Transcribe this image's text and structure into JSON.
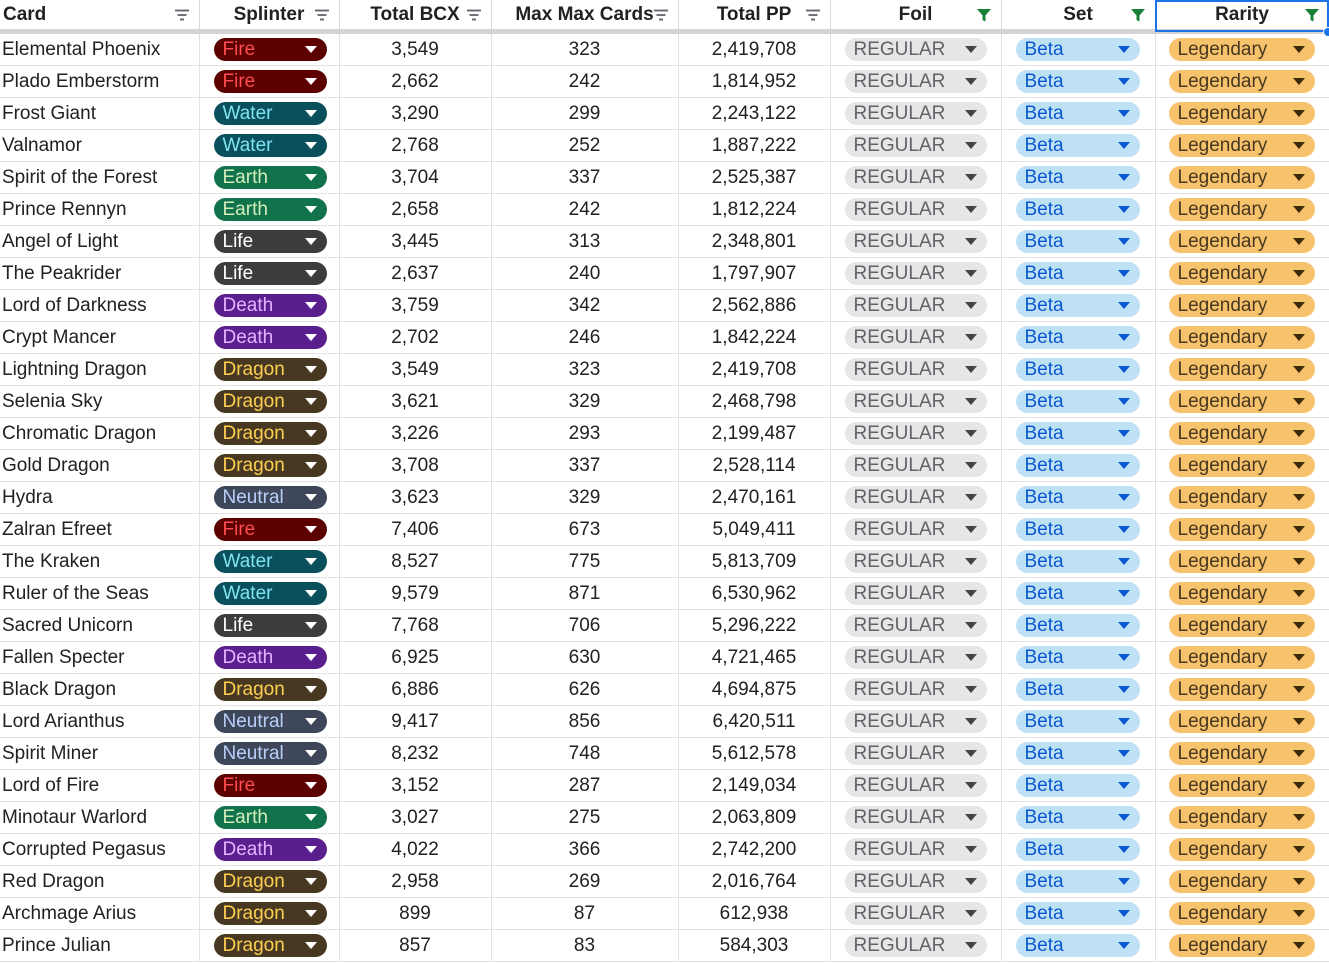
{
  "columns": [
    {
      "label": "Card",
      "filter_active": false
    },
    {
      "label": "Splinter",
      "filter_active": false
    },
    {
      "label": "Total BCX",
      "filter_active": false
    },
    {
      "label": "Max Max Cards",
      "filter_active": false
    },
    {
      "label": "Total PP",
      "filter_active": false
    },
    {
      "label": "Foil",
      "filter_active": true
    },
    {
      "label": "Set",
      "filter_active": true
    },
    {
      "label": "Rarity",
      "filter_active": true
    }
  ],
  "splinter_styles": {
    "Fire": {
      "bg": "#5c0000",
      "fg": "#ff4d4d"
    },
    "Water": {
      "bg": "#0a4f5c",
      "fg": "#7fe3f2"
    },
    "Earth": {
      "bg": "#11734b",
      "fg": "#d4edbc"
    },
    "Life": {
      "bg": "#3d3d3d",
      "fg": "#ffffff"
    },
    "Death": {
      "bg": "#5a1f8e",
      "fg": "#e3b3ff"
    },
    "Dragon": {
      "bg": "#473821",
      "fg": "#ffcf52"
    },
    "Neutral": {
      "bg": "#3d4759",
      "fg": "#b9cffa"
    }
  },
  "colors": {
    "active_filter_icon": "#188038",
    "inactive_filter_icon": "#5f6368",
    "selection": "#1a73e8"
  },
  "rows": [
    {
      "card": "Elemental Phoenix",
      "splinter": "Fire",
      "bcx": "3,549",
      "max_cards": "323",
      "pp": "2,419,708",
      "foil": "REGULAR",
      "set": "Beta",
      "rarity": "Legendary"
    },
    {
      "card": "Plado Emberstorm",
      "splinter": "Fire",
      "bcx": "2,662",
      "max_cards": "242",
      "pp": "1,814,952",
      "foil": "REGULAR",
      "set": "Beta",
      "rarity": "Legendary"
    },
    {
      "card": "Frost Giant",
      "splinter": "Water",
      "bcx": "3,290",
      "max_cards": "299",
      "pp": "2,243,122",
      "foil": "REGULAR",
      "set": "Beta",
      "rarity": "Legendary"
    },
    {
      "card": "Valnamor",
      "splinter": "Water",
      "bcx": "2,768",
      "max_cards": "252",
      "pp": "1,887,222",
      "foil": "REGULAR",
      "set": "Beta",
      "rarity": "Legendary"
    },
    {
      "card": "Spirit of the Forest",
      "splinter": "Earth",
      "bcx": "3,704",
      "max_cards": "337",
      "pp": "2,525,387",
      "foil": "REGULAR",
      "set": "Beta",
      "rarity": "Legendary"
    },
    {
      "card": "Prince Rennyn",
      "splinter": "Earth",
      "bcx": "2,658",
      "max_cards": "242",
      "pp": "1,812,224",
      "foil": "REGULAR",
      "set": "Beta",
      "rarity": "Legendary"
    },
    {
      "card": "Angel of Light",
      "splinter": "Life",
      "bcx": "3,445",
      "max_cards": "313",
      "pp": "2,348,801",
      "foil": "REGULAR",
      "set": "Beta",
      "rarity": "Legendary"
    },
    {
      "card": "The Peakrider",
      "splinter": "Life",
      "bcx": "2,637",
      "max_cards": "240",
      "pp": "1,797,907",
      "foil": "REGULAR",
      "set": "Beta",
      "rarity": "Legendary"
    },
    {
      "card": "Lord of Darkness",
      "splinter": "Death",
      "bcx": "3,759",
      "max_cards": "342",
      "pp": "2,562,886",
      "foil": "REGULAR",
      "set": "Beta",
      "rarity": "Legendary"
    },
    {
      "card": "Crypt Mancer",
      "splinter": "Death",
      "bcx": "2,702",
      "max_cards": "246",
      "pp": "1,842,224",
      "foil": "REGULAR",
      "set": "Beta",
      "rarity": "Legendary"
    },
    {
      "card": "Lightning Dragon",
      "splinter": "Dragon",
      "bcx": "3,549",
      "max_cards": "323",
      "pp": "2,419,708",
      "foil": "REGULAR",
      "set": "Beta",
      "rarity": "Legendary"
    },
    {
      "card": "Selenia Sky",
      "splinter": "Dragon",
      "bcx": "3,621",
      "max_cards": "329",
      "pp": "2,468,798",
      "foil": "REGULAR",
      "set": "Beta",
      "rarity": "Legendary"
    },
    {
      "card": "Chromatic Dragon",
      "splinter": "Dragon",
      "bcx": "3,226",
      "max_cards": "293",
      "pp": "2,199,487",
      "foil": "REGULAR",
      "set": "Beta",
      "rarity": "Legendary"
    },
    {
      "card": "Gold Dragon",
      "splinter": "Dragon",
      "bcx": "3,708",
      "max_cards": "337",
      "pp": "2,528,114",
      "foil": "REGULAR",
      "set": "Beta",
      "rarity": "Legendary"
    },
    {
      "card": "Hydra",
      "splinter": "Neutral",
      "bcx": "3,623",
      "max_cards": "329",
      "pp": "2,470,161",
      "foil": "REGULAR",
      "set": "Beta",
      "rarity": "Legendary"
    },
    {
      "card": "Zalran Efreet",
      "splinter": "Fire",
      "bcx": "7,406",
      "max_cards": "673",
      "pp": "5,049,411",
      "foil": "REGULAR",
      "set": "Beta",
      "rarity": "Legendary"
    },
    {
      "card": "The Kraken",
      "splinter": "Water",
      "bcx": "8,527",
      "max_cards": "775",
      "pp": "5,813,709",
      "foil": "REGULAR",
      "set": "Beta",
      "rarity": "Legendary"
    },
    {
      "card": "Ruler of the Seas",
      "splinter": "Water",
      "bcx": "9,579",
      "max_cards": "871",
      "pp": "6,530,962",
      "foil": "REGULAR",
      "set": "Beta",
      "rarity": "Legendary"
    },
    {
      "card": "Sacred Unicorn",
      "splinter": "Life",
      "bcx": "7,768",
      "max_cards": "706",
      "pp": "5,296,222",
      "foil": "REGULAR",
      "set": "Beta",
      "rarity": "Legendary"
    },
    {
      "card": "Fallen Specter",
      "splinter": "Death",
      "bcx": "6,925",
      "max_cards": "630",
      "pp": "4,721,465",
      "foil": "REGULAR",
      "set": "Beta",
      "rarity": "Legendary"
    },
    {
      "card": "Black Dragon",
      "splinter": "Dragon",
      "bcx": "6,886",
      "max_cards": "626",
      "pp": "4,694,875",
      "foil": "REGULAR",
      "set": "Beta",
      "rarity": "Legendary"
    },
    {
      "card": "Lord Arianthus",
      "splinter": "Neutral",
      "bcx": "9,417",
      "max_cards": "856",
      "pp": "6,420,511",
      "foil": "REGULAR",
      "set": "Beta",
      "rarity": "Legendary"
    },
    {
      "card": "Spirit Miner",
      "splinter": "Neutral",
      "bcx": "8,232",
      "max_cards": "748",
      "pp": "5,612,578",
      "foil": "REGULAR",
      "set": "Beta",
      "rarity": "Legendary"
    },
    {
      "card": "Lord of Fire",
      "splinter": "Fire",
      "bcx": "3,152",
      "max_cards": "287",
      "pp": "2,149,034",
      "foil": "REGULAR",
      "set": "Beta",
      "rarity": "Legendary"
    },
    {
      "card": "Minotaur Warlord",
      "splinter": "Earth",
      "bcx": "3,027",
      "max_cards": "275",
      "pp": "2,063,809",
      "foil": "REGULAR",
      "set": "Beta",
      "rarity": "Legendary"
    },
    {
      "card": "Corrupted Pegasus",
      "splinter": "Death",
      "bcx": "4,022",
      "max_cards": "366",
      "pp": "2,742,200",
      "foil": "REGULAR",
      "set": "Beta",
      "rarity": "Legendary"
    },
    {
      "card": "Red Dragon",
      "splinter": "Dragon",
      "bcx": "2,958",
      "max_cards": "269",
      "pp": "2,016,764",
      "foil": "REGULAR",
      "set": "Beta",
      "rarity": "Legendary"
    },
    {
      "card": "Archmage Arius",
      "splinter": "Dragon",
      "bcx": "899",
      "max_cards": "87",
      "pp": "612,938",
      "foil": "REGULAR",
      "set": "Beta",
      "rarity": "Legendary"
    },
    {
      "card": "Prince Julian",
      "splinter": "Dragon",
      "bcx": "857",
      "max_cards": "83",
      "pp": "584,303",
      "foil": "REGULAR",
      "set": "Beta",
      "rarity": "Legendary"
    }
  ]
}
